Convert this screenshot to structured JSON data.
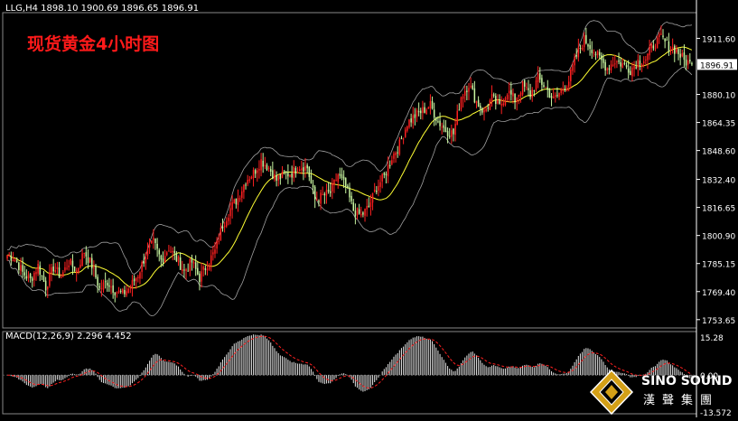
{
  "chart_data": [
    {
      "type": "candlestick",
      "symbol": "LLG",
      "timeframe": "H4",
      "header": "LLG,H4  1898.10 1900.69 1896.65 1896.91",
      "title": "现货黄金4小时图",
      "ohlc": {
        "open": 1898.1,
        "high": 1900.69,
        "low": 1896.65,
        "close": 1896.91
      },
      "current_price": "1896.91",
      "ylim": [
        1750,
        1925
      ],
      "y_ticks": [
        "1911.60",
        "1880.10",
        "1864.35",
        "1848.60",
        "1832.40",
        "1816.65",
        "1800.90",
        "1785.15",
        "1769.40",
        "1753.65"
      ],
      "indicators": [
        "Bollinger Bands",
        "Moving Average"
      ],
      "colors": {
        "bull": "#ff2020",
        "bear": "#c8f5a0",
        "ma": "#ffff33",
        "bands": "#a0a0a0",
        "axis": "#ffffff"
      },
      "close_path": [
        1790,
        1788,
        1780,
        1776,
        1784,
        1772,
        1783,
        1778,
        1786,
        1781,
        1792,
        1784,
        1771,
        1775,
        1770,
        1768,
        1772,
        1779,
        1790,
        1797,
        1787,
        1794,
        1788,
        1781,
        1786,
        1777,
        1785,
        1792,
        1807,
        1816,
        1822,
        1832,
        1836,
        1843,
        1839,
        1832,
        1835,
        1836,
        1840,
        1839,
        1821,
        1823,
        1825,
        1835,
        1828,
        1815,
        1812,
        1817,
        1828,
        1834,
        1845,
        1852,
        1864,
        1868,
        1871,
        1874,
        1865,
        1860,
        1858,
        1879,
        1886,
        1876,
        1870,
        1878,
        1873,
        1882,
        1877,
        1885,
        1880,
        1889,
        1884,
        1877,
        1882,
        1888,
        1902,
        1911,
        1906,
        1900,
        1895,
        1899,
        1897,
        1894,
        1899,
        1900,
        1908,
        1912,
        1907,
        1905,
        1899,
        1896.91
      ]
    },
    {
      "type": "bar",
      "indicator": "MACD(12,26,9) 2.296 4.452",
      "params": [
        12,
        26,
        9
      ],
      "macd": 2.296,
      "signal": 4.452,
      "ylim": [
        -13.572,
        15.28
      ],
      "y_ticks": [
        "15.28",
        "0.00",
        "-13.572"
      ],
      "colors": {
        "histogram": "#d8d8d8",
        "signal": "#ff2020"
      }
    }
  ],
  "watermark": {
    "brand": "SINO SOUND",
    "chinese": "漢聲集團"
  }
}
